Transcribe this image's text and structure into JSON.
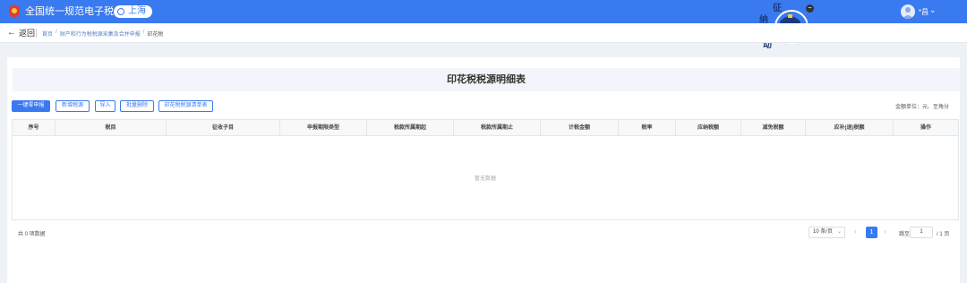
{
  "header": {
    "app_title": "全国统一规范电子税务局",
    "region": "上海",
    "username": "*昌",
    "mascot_text": [
      "征",
      "纳",
      "互",
      "动"
    ]
  },
  "nav": {
    "back_label": "返回",
    "breadcrumb": [
      "首页",
      "财产和行为税税源采集及合并申报",
      "印花税"
    ]
  },
  "form": {
    "title": "印花税税源明细表",
    "unit_label": "金额单位：元、至角分",
    "buttons": {
      "one_click_zero": "一键零申报",
      "add_source": "新增税源",
      "import": "导入",
      "batch_delete": "批量删除",
      "print_source": "印花税税源清单表"
    }
  },
  "table": {
    "columns": [
      "序号",
      "税目",
      "征收子目",
      "申报期限类型",
      "税款所属期起",
      "税款所属期止",
      "计税金额",
      "税率",
      "应纳税额",
      "减免税额",
      "应补(退)税额",
      "操作"
    ],
    "empty_text": "暂无数据"
  },
  "pagination": {
    "total_text": "共 0 项数据",
    "page_size": "10 条/页",
    "current_page": "1",
    "goto_label": "跳至",
    "goto_value": "1",
    "total_pages": "/ 1 页"
  },
  "colors": {
    "primary": "#3a7af0",
    "page_bg": "#eef1f6"
  }
}
